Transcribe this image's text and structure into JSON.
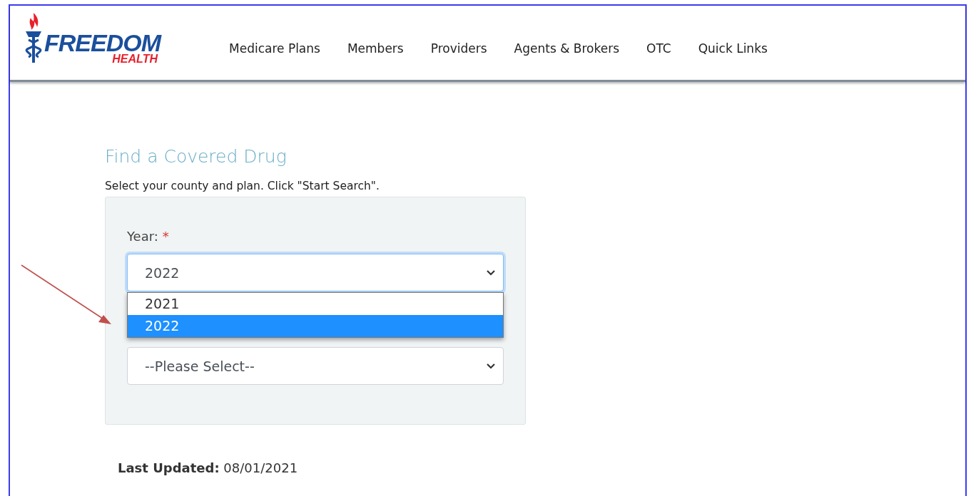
{
  "logo": {
    "name": "FREEDOM",
    "sub": "HEALTH"
  },
  "nav": [
    {
      "label": "Medicare Plans"
    },
    {
      "label": "Members"
    },
    {
      "label": "Providers"
    },
    {
      "label": "Agents & Brokers"
    },
    {
      "label": "OTC"
    },
    {
      "label": "Quick Links"
    }
  ],
  "title": "Find a Covered Drug",
  "instructions": "Select your county and plan. Click \"Start Search\".",
  "form": {
    "year_label": "Year:",
    "required_mark": "*",
    "year_select": {
      "value": "2022",
      "expanded": true,
      "options": [
        {
          "label": "2021",
          "selected": false
        },
        {
          "label": "2022",
          "selected": true
        }
      ]
    },
    "plan_select": {
      "value": "--Please Select--"
    }
  },
  "last_updated": "**Last Updated:** 08/01/2021"
}
